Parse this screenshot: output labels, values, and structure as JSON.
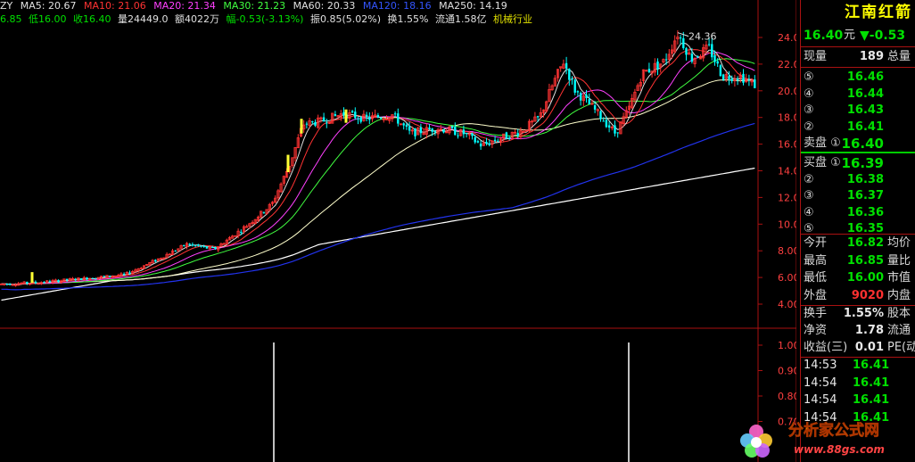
{
  "header_top": {
    "indicator": "ZY",
    "ma": [
      {
        "label": "MA5: 20.67",
        "color": "#e0e0e0"
      },
      {
        "label": "MA10: 21.06",
        "color": "#ff3333"
      },
      {
        "label": "MA20: 21.34",
        "color": "#ff40ff"
      },
      {
        "label": "MA30: 21.23",
        "color": "#40ff40"
      },
      {
        "label": "MA60: 20.33",
        "color": "#e0e0e0"
      },
      {
        "label": "MA120: 18.16",
        "color": "#3355ff"
      },
      {
        "label": "MA250: 14.19",
        "color": "#e0e0e0"
      }
    ]
  },
  "header_bottom": [
    {
      "text": "6.85",
      "color": "#00e000"
    },
    {
      "text": "低16.00",
      "color": "#00e000"
    },
    {
      "text": "收16.40",
      "color": "#00e000"
    },
    {
      "text": "量24449.0",
      "color": "#e0e0e0"
    },
    {
      "text": "额4022万",
      "color": "#e0e0e0"
    },
    {
      "text": "幅-0.53(-3.13%)",
      "color": "#00e000"
    },
    {
      "text": "振0.85(5.02%)",
      "color": "#e0e0e0"
    },
    {
      "text": "换1.55%",
      "color": "#e0e0e0"
    },
    {
      "text": "流通1.58亿",
      "color": "#e0e0e0"
    },
    {
      "text": "机械行业",
      "color": "#e0e000"
    }
  ],
  "price_axis": [
    "24.00",
    "22.00",
    "20.00",
    "18.00",
    "16.00",
    "14.00",
    "12.00",
    "10.00",
    "8.00",
    "6.00",
    "4.00"
  ],
  "volume_axis": [
    "1.00",
    "0.90",
    "0.80",
    "0.70"
  ],
  "peak_label": "24.36",
  "colors": {
    "up": "#ff3333",
    "down": "#00ffff",
    "ma5": "#e0e0e0",
    "ma10": "#ff3333",
    "ma20": "#ff40ff",
    "ma30": "#40ff40",
    "ma60": "#ffffcc",
    "ma120": "#2233ee",
    "ma250": "#ffffff"
  },
  "chart_data": {
    "type": "candlestick",
    "title": "",
    "ylim": [
      4,
      24.5
    ],
    "yticks": [
      24,
      22,
      20,
      18,
      16,
      14,
      12,
      10,
      8,
      6,
      4
    ],
    "last_close": 16.4,
    "ma_last": {
      "MA5": 20.67,
      "MA10": 21.06,
      "MA20": 21.34,
      "MA30": 21.23,
      "MA60": 20.33,
      "MA120": 18.16,
      "MA250": 14.19
    }
  },
  "panel": {
    "stock_name": "江南红箭",
    "price": "16.40",
    "price_unit": "元",
    "change": "▼-0.53",
    "xianliang_label": "现量",
    "xianliang_value": "189",
    "zongliang_label": "总量",
    "sells": [
      {
        "label": "⑤",
        "value": "16.46"
      },
      {
        "label": "④",
        "value": "16.44"
      },
      {
        "label": "③",
        "value": "16.43"
      },
      {
        "label": "②",
        "value": "16.41"
      },
      {
        "label": "卖盘 ①",
        "value": "16.40"
      }
    ],
    "buys": [
      {
        "label": "买盘 ①",
        "value": "16.39"
      },
      {
        "label": "②",
        "value": "16.38"
      },
      {
        "label": "③",
        "value": "16.37"
      },
      {
        "label": "④",
        "value": "16.36"
      },
      {
        "label": "⑤",
        "value": "16.35"
      }
    ],
    "stats1": [
      {
        "label": "今开",
        "value": "16.82",
        "color": "#00e000",
        "ext": "均价"
      },
      {
        "label": "最高",
        "value": "16.85",
        "color": "#00e000",
        "ext": "量比"
      },
      {
        "label": "最低",
        "value": "16.00",
        "color": "#00e000",
        "ext": "市值"
      },
      {
        "label": "外盘",
        "value": "9020",
        "color": "#ff3030",
        "ext": "内盘"
      }
    ],
    "stats2": [
      {
        "label": "换手",
        "value": "1.55%",
        "color": "#e8e8e8",
        "ext": "股本"
      },
      {
        "label": "净资",
        "value": "1.78",
        "color": "#e8e8e8",
        "ext": "流通"
      },
      {
        "label": "收益(三)",
        "value": "0.01",
        "color": "#e8e8e8",
        "ext": "PE(动"
      }
    ],
    "ticks": [
      {
        "time": "14:53",
        "value": "16.41"
      },
      {
        "time": "14:54",
        "value": "16.41"
      },
      {
        "time": "14:54",
        "value": "16.41"
      },
      {
        "time": "14:54",
        "value": "16.41"
      }
    ]
  },
  "watermark": {
    "title": "分析家公式网",
    "url": "www.88gs.com"
  }
}
